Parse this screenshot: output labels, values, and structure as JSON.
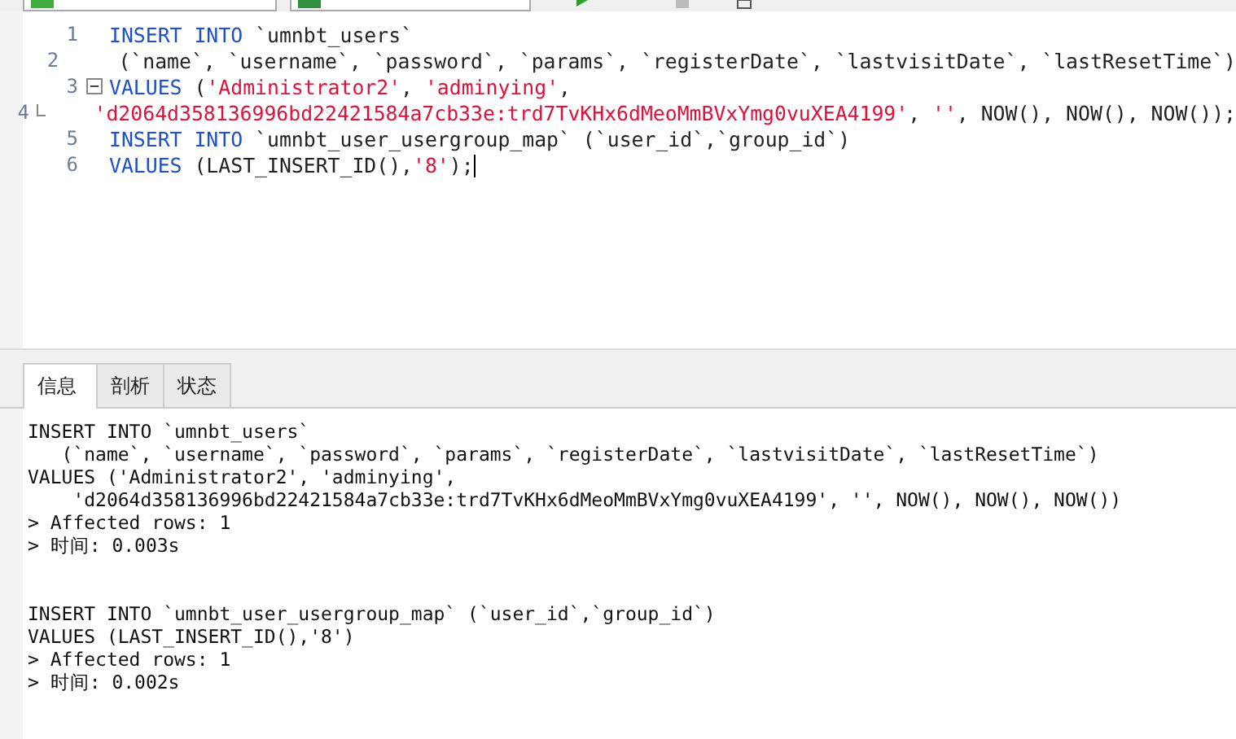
{
  "editor": {
    "lines": [
      {
        "number": "1",
        "kind": "code",
        "segments": [
          {
            "kind": "keyword",
            "text": "INSERT INTO"
          },
          {
            "kind": "plain",
            "text": " `umnbt_users`"
          }
        ]
      },
      {
        "number": "2",
        "kind": "code",
        "segments": [
          {
            "kind": "plain",
            "text": "   (`name`, `username`, `password`, `params`, `registerDate`, `lastvisitDate`, `lastResetTime`)"
          }
        ]
      },
      {
        "number": "3",
        "kind": "fold-start",
        "segments": [
          {
            "kind": "keyword",
            "text": "VALUES"
          },
          {
            "kind": "plain",
            "text": " ("
          },
          {
            "kind": "string",
            "text": "'Administrator2'"
          },
          {
            "kind": "plain",
            "text": ", "
          },
          {
            "kind": "string",
            "text": "'adminying'"
          },
          {
            "kind": "plain",
            "text": ","
          }
        ]
      },
      {
        "number": "4",
        "kind": "fold-end",
        "segments": [
          {
            "kind": "string",
            "text": "'d2064d358136996bd22421584a7cb33e:trd7TvKHx6dMeoMmBVxYmg0vuXEA4199'"
          },
          {
            "kind": "plain",
            "text": ", "
          },
          {
            "kind": "string",
            "text": "''"
          },
          {
            "kind": "plain",
            "text": ", NOW(), NOW(), NOW());"
          }
        ]
      },
      {
        "number": "5",
        "kind": "code",
        "segments": [
          {
            "kind": "keyword",
            "text": "INSERT INTO"
          },
          {
            "kind": "plain",
            "text": " `umnbt_user_usergroup_map` (`user_id`,`group_id`)"
          }
        ]
      },
      {
        "number": "6",
        "kind": "code",
        "caret": true,
        "segments": [
          {
            "kind": "keyword",
            "text": "VALUES"
          },
          {
            "kind": "plain",
            "text": " (LAST_INSERT_ID(),"
          },
          {
            "kind": "string",
            "text": "'8'"
          },
          {
            "kind": "plain",
            "text": ");"
          }
        ]
      }
    ]
  },
  "tabs": [
    {
      "label": "信息",
      "selected": true
    },
    {
      "label": "剖析",
      "selected": false
    },
    {
      "label": "状态",
      "selected": false
    }
  ],
  "output": {
    "blocks": [
      [
        "INSERT INTO `umnbt_users`",
        "   (`name`, `username`, `password`, `params`, `registerDate`, `lastvisitDate`, `lastResetTime`)",
        "VALUES ('Administrator2', 'adminying',",
        "    'd2064d358136996bd22421584a7cb33e:trd7TvKHx6dMeoMmBVxYmg0vuXEA4199', '', NOW(), NOW(), NOW())",
        "> Affected rows: 1",
        "> 时间: 0.003s"
      ],
      [
        "INSERT INTO `umnbt_user_usergroup_map` (`user_id`,`group_id`)",
        "VALUES (LAST_INSERT_ID(),'8')",
        "> Affected rows: 1",
        "> 时间: 0.002s"
      ]
    ]
  }
}
